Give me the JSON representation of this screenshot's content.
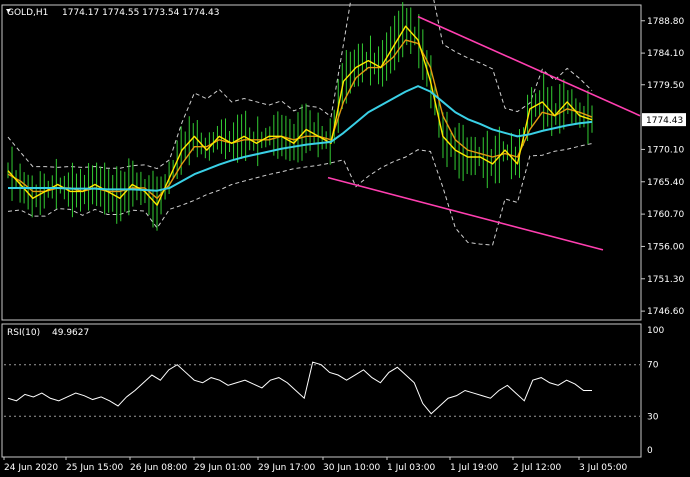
{
  "chart_data": [
    {
      "type": "line",
      "symbol": "GOLD,H1",
      "ohlc_text": "1774.17 1774.55 1773.54 1774.43",
      "current_price": 1774.43,
      "ylim": [
        1745.6,
        1790.8
      ],
      "y_ticks": [
        "1788.80",
        "1784.10",
        "1779.50",
        "1774.83",
        "1770.10",
        "1765.40",
        "1760.70",
        "1756.00",
        "1751.30",
        "1746.60"
      ],
      "x_ticks": [
        "24 Jun 2020",
        "25 Jun 15:00",
        "26 Jun 08:00",
        "29 Jun 01:00",
        "29 Jun 17:00",
        "30 Jun 10:00",
        "1 Jul 03:00",
        "1 Jul 19:00",
        "2 Jul 12:00",
        "3 Jul 05:00"
      ],
      "series": [
        {
          "values": [
            1767,
            1765,
            1763,
            1764,
            1765,
            1764,
            1764,
            1765,
            1764,
            1763,
            1765,
            1764,
            1762,
            1766,
            1770,
            1772,
            1770,
            1772,
            1771,
            1772,
            1771,
            1772,
            1772,
            1771,
            1773,
            1772,
            1771,
            1780,
            1782,
            1783,
            1782,
            1785,
            1788,
            1786,
            1780,
            1772,
            1770,
            1769,
            1769,
            1768,
            1770,
            1768,
            1776,
            1777,
            1775,
            1777,
            1775,
            1774.4
          ]
        },
        {
          "values": [
            1766.5,
            1765.5,
            1764,
            1764,
            1764.5,
            1764.5,
            1764,
            1764.5,
            1764,
            1764,
            1764.5,
            1764.5,
            1763,
            1765,
            1768,
            1770.5,
            1770.5,
            1771.5,
            1771,
            1771.5,
            1771.5,
            1771.5,
            1772,
            1771.5,
            1772,
            1772,
            1771.5,
            1777,
            1780.5,
            1782,
            1782,
            1783.5,
            1786,
            1785.5,
            1782,
            1775,
            1771.5,
            1770,
            1769.5,
            1769,
            1769.5,
            1769,
            1773,
            1775.5,
            1775,
            1776,
            1775.5,
            1774.8
          ]
        },
        {
          "values": [
            1764.5,
            1764.5,
            1764.5,
            1764.5,
            1764.5,
            1764.4,
            1764.4,
            1764.4,
            1764.3,
            1764.3,
            1764.3,
            1764.2,
            1764.1,
            1764.5,
            1765.5,
            1766.5,
            1767.2,
            1767.9,
            1768.5,
            1769,
            1769.4,
            1769.8,
            1770.2,
            1770.5,
            1770.8,
            1771,
            1771.2,
            1772.5,
            1774,
            1775.5,
            1776.5,
            1777.5,
            1778.5,
            1779.3,
            1778.5,
            1777,
            1775.5,
            1774.5,
            1773.8,
            1773,
            1772.5,
            1772,
            1772.3,
            1772.8,
            1773.2,
            1773.6,
            1773.9,
            1774.1
          ]
        }
      ],
      "trendlines": [
        {
          "points": [
            [
              "1 Jul 01:00",
              1789.4
            ],
            [
              "3 Jul 08:00",
              1775.0
            ]
          ]
        },
        {
          "points": [
            [
              "30 Jun 10:00",
              1766.0
            ],
            [
              "3 Jul 06:00",
              1755.5
            ]
          ]
        }
      ]
    },
    {
      "type": "line",
      "indicator": "RSI(10)",
      "value_text": "49.9627",
      "ylim": [
        0,
        100
      ],
      "levels": [
        30,
        70
      ],
      "y_ticks": [
        "100",
        "70",
        "30",
        "0"
      ],
      "values": [
        44,
        42,
        47,
        45,
        48,
        44,
        42,
        45,
        48,
        46,
        43,
        45,
        42,
        38,
        45,
        50,
        56,
        62,
        58,
        66,
        70,
        64,
        58,
        56,
        60,
        58,
        54,
        56,
        58,
        55,
        52,
        58,
        60,
        56,
        50,
        44,
        72,
        70,
        64,
        62,
        58,
        62,
        66,
        60,
        56,
        64,
        68,
        62,
        56,
        40,
        32,
        38,
        44,
        46,
        50,
        48,
        46,
        44,
        50,
        54,
        48,
        42,
        58,
        60,
        56,
        54,
        58,
        55,
        50,
        49.96
      ]
    }
  ]
}
